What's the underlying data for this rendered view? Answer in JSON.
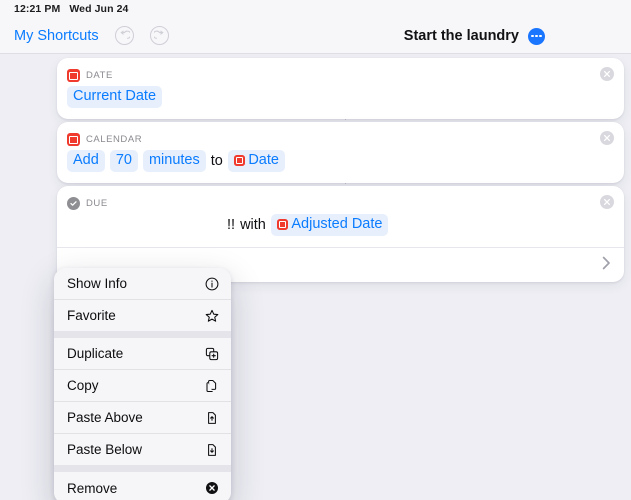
{
  "status_bar": {
    "time": "12:21 PM",
    "date": "Wed Jun 24"
  },
  "toolbar": {
    "back_label": "My Shortcuts",
    "undo_icon": "undo-icon",
    "redo_icon": "redo-icon",
    "shortcut_title": "Start the laundry",
    "more_icon": "ellipsis-icon"
  },
  "accent": {
    "blue": "#0a7cff",
    "red": "#f03a2e",
    "gray": "#8e8e93",
    "background": "#eeeef4"
  },
  "actions": [
    {
      "category": "DATE",
      "icon": "calendar-app-icon",
      "tokens": [
        {
          "type": "token",
          "text": "Current Date"
        }
      ],
      "close_icon": "close-icon"
    },
    {
      "category": "CALENDAR",
      "icon": "calendar-app-icon",
      "tokens": [
        {
          "type": "token",
          "text": "Add"
        },
        {
          "type": "token",
          "text": "70"
        },
        {
          "type": "token",
          "text": "minutes"
        },
        {
          "type": "plain",
          "text": "to"
        },
        {
          "type": "token",
          "text": "Date",
          "icon": "calendar-app-icon"
        }
      ],
      "close_icon": "close-icon"
    },
    {
      "category": "DUE",
      "icon": "reminders-check-icon",
      "tokens": [
        {
          "type": "plain",
          "text": "!!"
        },
        {
          "type": "plain",
          "text": "with"
        },
        {
          "type": "token",
          "text": "Adjusted Date",
          "icon": "calendar-app-icon"
        }
      ],
      "close_icon": "close-icon",
      "expand_icon": "chevron-right-icon"
    }
  ],
  "context_menu": {
    "groups": [
      [
        {
          "label": "Show Info",
          "icon": "info-circle-icon"
        },
        {
          "label": "Favorite",
          "icon": "star-icon"
        }
      ],
      [
        {
          "label": "Duplicate",
          "icon": "duplicate-icon"
        },
        {
          "label": "Copy",
          "icon": "copy-icon"
        },
        {
          "label": "Paste Above",
          "icon": "paste-above-icon"
        },
        {
          "label": "Paste Below",
          "icon": "paste-below-icon"
        }
      ],
      [
        {
          "label": "Remove",
          "icon": "remove-circle-icon"
        }
      ]
    ]
  }
}
